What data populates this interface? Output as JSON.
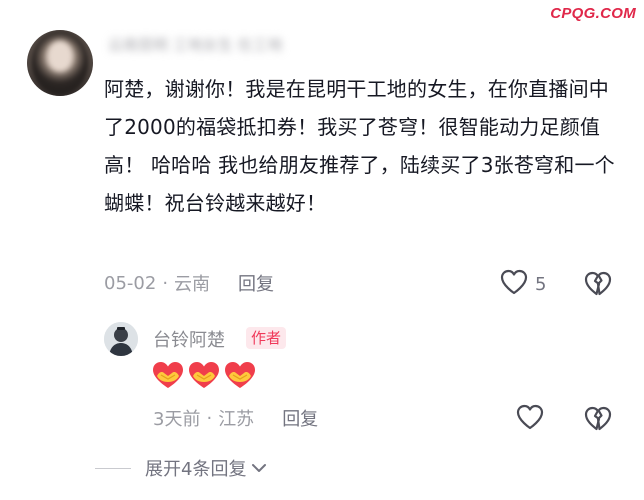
{
  "watermark": "CPQG.COM",
  "comment": {
    "username": "云南昆明 工地女生 在工地",
    "text": "阿楚，谢谢你！我是在昆明干工地的女生，在你直播间中了2000的福袋抵扣券！我买了苍穹！很智能动力足颜值高！ 哈哈哈 我也给朋友推荐了，陆续买了3张苍穹和一个蝴蝶！祝台铃越来越好！",
    "date": "05-02",
    "location": "云南",
    "separator": "·",
    "reply_label": "回复",
    "like_count": "5",
    "like_icon": "heart-outline-icon",
    "dislike_icon": "broken-heart-icon"
  },
  "reply": {
    "username": "台铃阿楚",
    "badge": "作者",
    "emoji": [
      "🫶",
      "🫶",
      "🫶"
    ],
    "time": "3天前",
    "location": "江苏",
    "separator": "·",
    "reply_label": "回复"
  },
  "expand": {
    "label": "展开4条回复",
    "icon": "chevron-down-icon"
  },
  "colors": {
    "accent": "#e0284a",
    "badge_text": "#f0395a",
    "badge_bg": "#fde8ec",
    "meta_text": "#9b9ca3"
  }
}
